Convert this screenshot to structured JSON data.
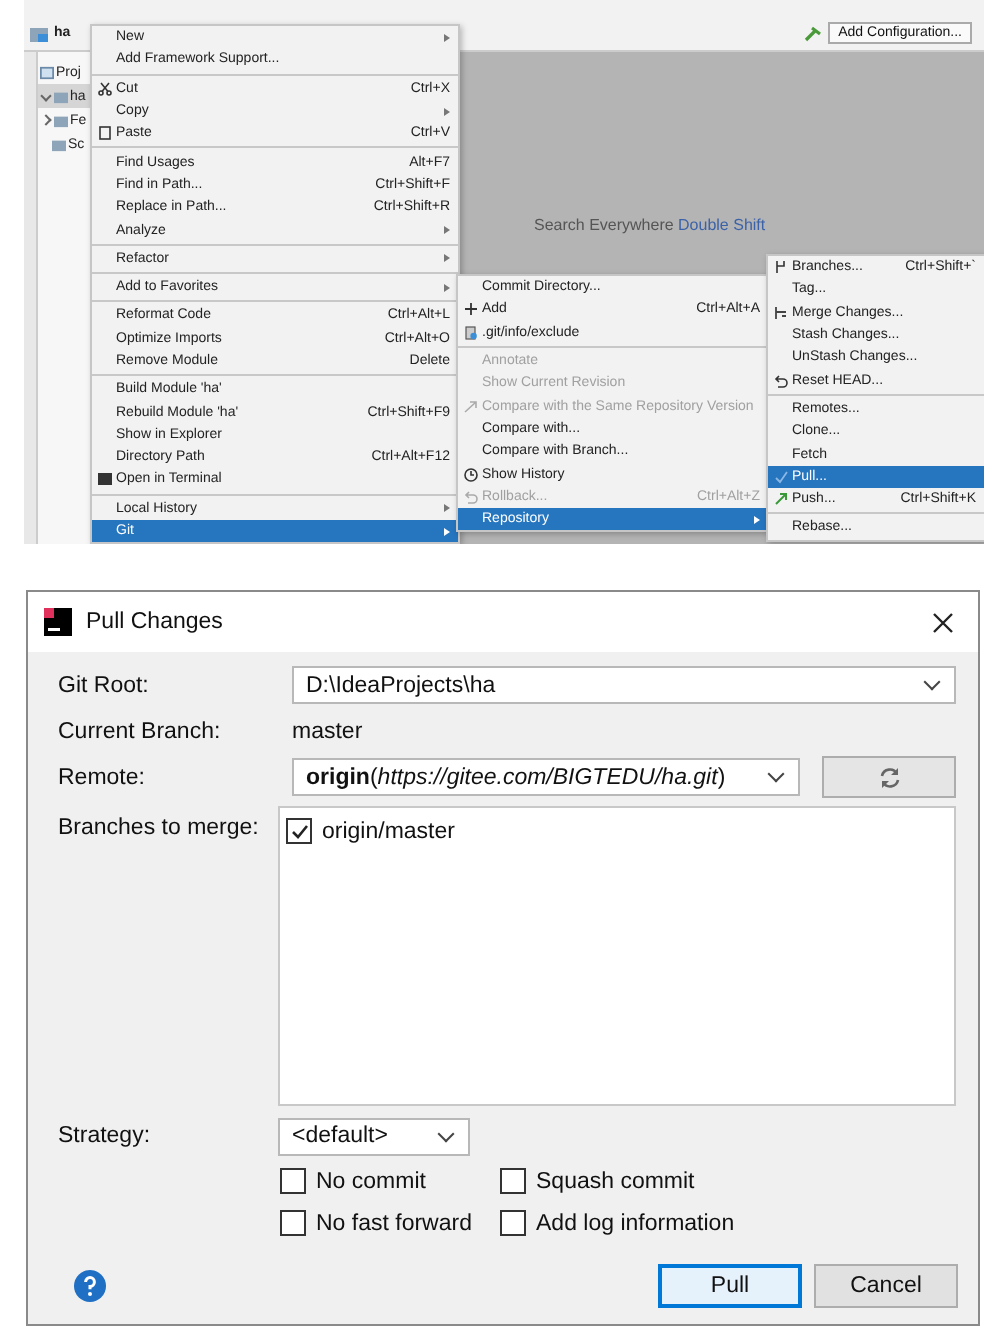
{
  "ide": {
    "project_title": "ha",
    "toolbar_button": "Add Configuration...",
    "project_panel": {
      "title": "Proj",
      "tree": [
        {
          "label": "ha",
          "expanded": true
        },
        {
          "label": "Fe",
          "expanded": false
        },
        {
          "label": "Sc"
        }
      ]
    },
    "editor_hint": "Search Everywhere",
    "editor_hint_shortcut": "Double Shift",
    "context_menu": [
      {
        "label": "New",
        "submenu": true,
        "separator_before": false,
        "selected": false
      },
      {
        "label": "Add Framework Support...",
        "submenu": false,
        "separator_before": false,
        "selected": false
      },
      {
        "label": "Cut",
        "shortcut": "Ctrl+X",
        "submenu": false,
        "separator_before": true,
        "selected": false
      },
      {
        "label": "Copy",
        "submenu": true,
        "separator_before": false,
        "selected": false
      },
      {
        "label": "Paste",
        "shortcut": "Ctrl+V",
        "submenu": false,
        "separator_before": false,
        "selected": false
      },
      {
        "label": "Find Usages",
        "shortcut": "Alt+F7",
        "submenu": false,
        "separator_before": true,
        "selected": false
      },
      {
        "label": "Find in Path...",
        "shortcut": "Ctrl+Shift+F",
        "submenu": false,
        "separator_before": false,
        "selected": false
      },
      {
        "label": "Replace in Path...",
        "shortcut": "Ctrl+Shift+R",
        "submenu": false,
        "separator_before": false,
        "selected": false
      },
      {
        "label": "Analyze",
        "submenu": true,
        "separator_before": false,
        "selected": false
      },
      {
        "label": "Refactor",
        "submenu": true,
        "separator_before": true,
        "selected": false
      },
      {
        "label": "Add to Favorites",
        "submenu": true,
        "separator_before": true,
        "selected": false
      },
      {
        "label": "Reformat Code",
        "shortcut": "Ctrl+Alt+L",
        "submenu": false,
        "separator_before": true,
        "selected": false
      },
      {
        "label": "Optimize Imports",
        "shortcut": "Ctrl+Alt+O",
        "submenu": false,
        "separator_before": false,
        "selected": false
      },
      {
        "label": "Remove Module",
        "shortcut": "Delete",
        "submenu": false,
        "separator_before": false,
        "selected": false
      },
      {
        "label": "Build Module 'ha'",
        "submenu": false,
        "separator_before": true,
        "selected": false
      },
      {
        "label": "Rebuild Module 'ha'",
        "shortcut": "Ctrl+Shift+F9",
        "submenu": false,
        "separator_before": false,
        "selected": false
      },
      {
        "label": "Show in Explorer",
        "submenu": false,
        "separator_before": false,
        "selected": false
      },
      {
        "label": "Directory Path",
        "shortcut": "Ctrl+Alt+F12",
        "submenu": false,
        "separator_before": false,
        "selected": false
      },
      {
        "label": "Open in Terminal",
        "submenu": false,
        "separator_before": false,
        "selected": false
      },
      {
        "label": "Local History",
        "submenu": true,
        "separator_before": true,
        "selected": false
      },
      {
        "label": "Git",
        "submenu": true,
        "separator_before": false,
        "selected": true
      }
    ],
    "git_menu": [
      {
        "label": "Commit Directory...",
        "submenu": false,
        "separator_before": false,
        "disabled": false,
        "selected": false
      },
      {
        "label": "Add",
        "shortcut": "Ctrl+Alt+A",
        "submenu": false,
        "separator_before": false,
        "disabled": false,
        "selected": false
      },
      {
        "label": ".git/info/exclude",
        "submenu": false,
        "separator_before": false,
        "disabled": false,
        "selected": false
      },
      {
        "label": "Annotate",
        "submenu": false,
        "separator_before": true,
        "disabled": true,
        "selected": false
      },
      {
        "label": "Show Current Revision",
        "submenu": false,
        "separator_before": false,
        "disabled": true,
        "selected": false
      },
      {
        "label": "Compare with the Same Repository Version",
        "submenu": false,
        "separator_before": false,
        "disabled": true,
        "selected": false
      },
      {
        "label": "Compare with...",
        "submenu": false,
        "separator_before": false,
        "disabled": false,
        "selected": false
      },
      {
        "label": "Compare with Branch...",
        "submenu": false,
        "separator_before": false,
        "disabled": false,
        "selected": false
      },
      {
        "label": "Show History",
        "submenu": false,
        "separator_before": false,
        "disabled": false,
        "selected": false
      },
      {
        "label": "Rollback...",
        "shortcut": "Ctrl+Alt+Z",
        "submenu": false,
        "separator_before": false,
        "disabled": true,
        "selected": false
      },
      {
        "label": "Repository",
        "submenu": true,
        "separator_before": false,
        "disabled": false,
        "selected": true
      }
    ],
    "repository_menu": [
      {
        "label": "Branches...",
        "shortcut": "Ctrl+Shift+`",
        "submenu": false,
        "separator_before": false,
        "selected": false
      },
      {
        "label": "Tag...",
        "submenu": false,
        "separator_before": false,
        "selected": false
      },
      {
        "label": "Merge Changes...",
        "submenu": false,
        "separator_before": false,
        "selected": false
      },
      {
        "label": "Stash Changes...",
        "submenu": false,
        "separator_before": false,
        "selected": false
      },
      {
        "label": "UnStash Changes...",
        "submenu": false,
        "separator_before": false,
        "selected": false
      },
      {
        "label": "Reset HEAD...",
        "submenu": false,
        "separator_before": false,
        "selected": false
      },
      {
        "label": "Remotes...",
        "submenu": false,
        "separator_before": true,
        "selected": false
      },
      {
        "label": "Clone...",
        "submenu": false,
        "separator_before": false,
        "selected": false
      },
      {
        "label": "Fetch",
        "submenu": false,
        "separator_before": false,
        "selected": false
      },
      {
        "label": "Pull...",
        "submenu": false,
        "separator_before": false,
        "selected": true
      },
      {
        "label": "Push...",
        "shortcut": "Ctrl+Shift+K",
        "submenu": false,
        "separator_before": false,
        "selected": false
      },
      {
        "label": "Rebase...",
        "submenu": false,
        "separator_before": true,
        "selected": false
      }
    ]
  },
  "dialog": {
    "title": "Pull Changes",
    "git_root_label": "Git Root:",
    "git_root": "D:\\IdeaProjects\\ha",
    "current_branch_label": "Current Branch:",
    "current_branch": "master",
    "remote_label": "Remote:",
    "remote": "**origin**(*https://gitee.com/BIGTEDU/ha.git*)",
    "branches_label": "Branches to merge:",
    "branches": [
      {
        "label": "origin/master",
        "checked": true
      }
    ],
    "strategy_label": "Strategy:",
    "strategy": "<default>",
    "options": [
      {
        "label": "No commit",
        "checked": false
      },
      {
        "label": "Squash commit",
        "checked": false
      },
      {
        "label": "No fast forward",
        "checked": false
      },
      {
        "label": "Add log information",
        "checked": false
      }
    ],
    "buttons": [
      {
        "label": "Pull",
        "default": true
      },
      {
        "label": "Cancel",
        "default": false
      }
    ]
  }
}
